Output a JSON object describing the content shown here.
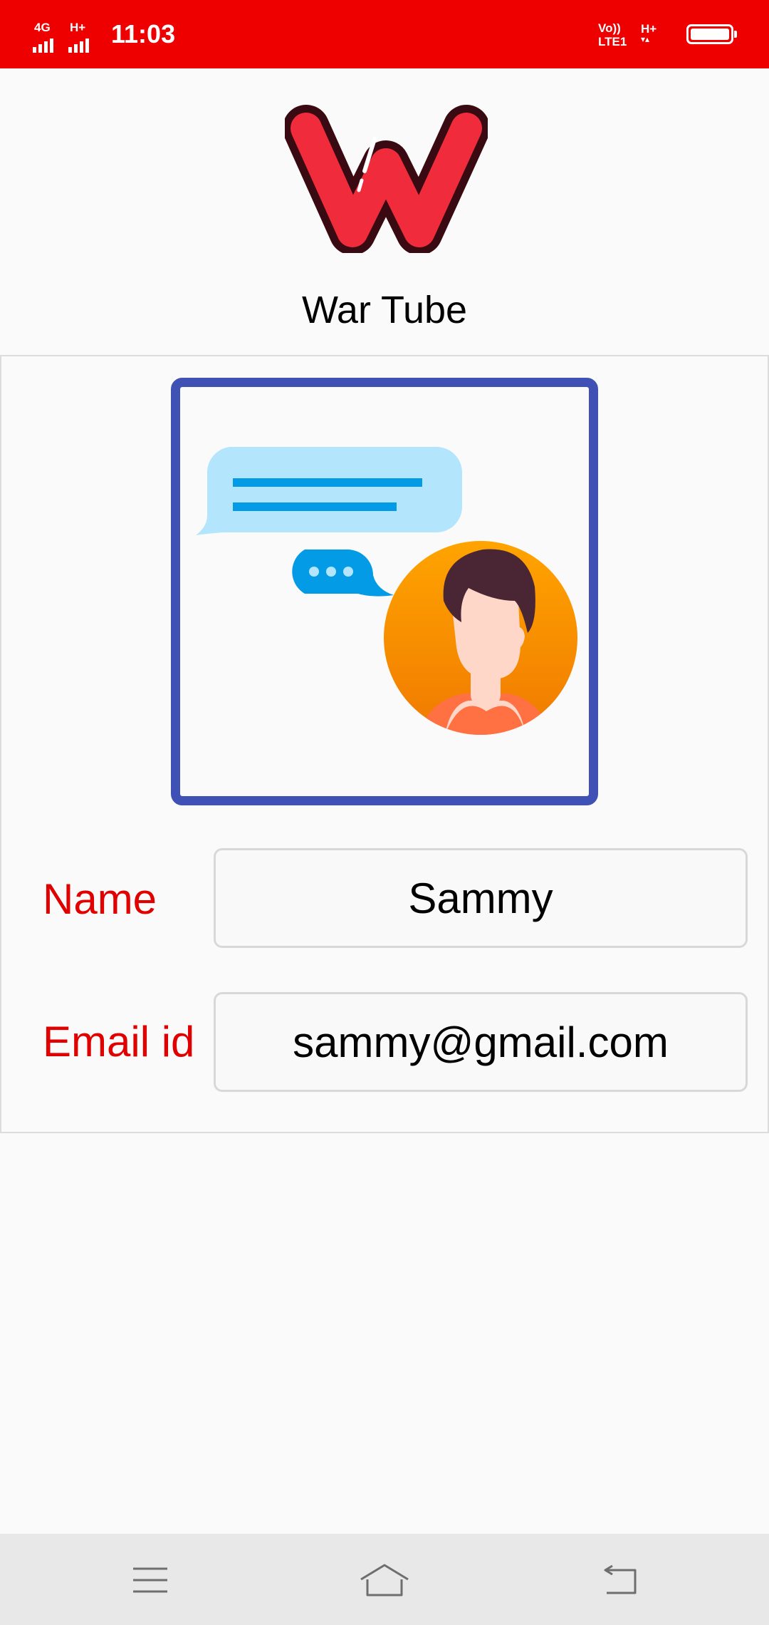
{
  "status_bar": {
    "network_1": "4G",
    "network_2": "H+",
    "time": "11:03",
    "volte_line1": "Vo))",
    "volte_line2": "LTE1",
    "data_type": "H+",
    "background_color": "#ee0000"
  },
  "header": {
    "logo_icon": "w-logo-icon",
    "title": "War Tube"
  },
  "illustration": {
    "icon": "chat-person-illustration",
    "border_color": "#3f51b5"
  },
  "form": {
    "name_label": "Name",
    "name_value": "Sammy",
    "email_label": "Email id",
    "email_value": "sammy@gmail.com",
    "label_color": "#e00000"
  },
  "nav_bar": {
    "menu_icon": "menu-icon",
    "home_icon": "home-icon",
    "back_icon": "back-icon"
  }
}
